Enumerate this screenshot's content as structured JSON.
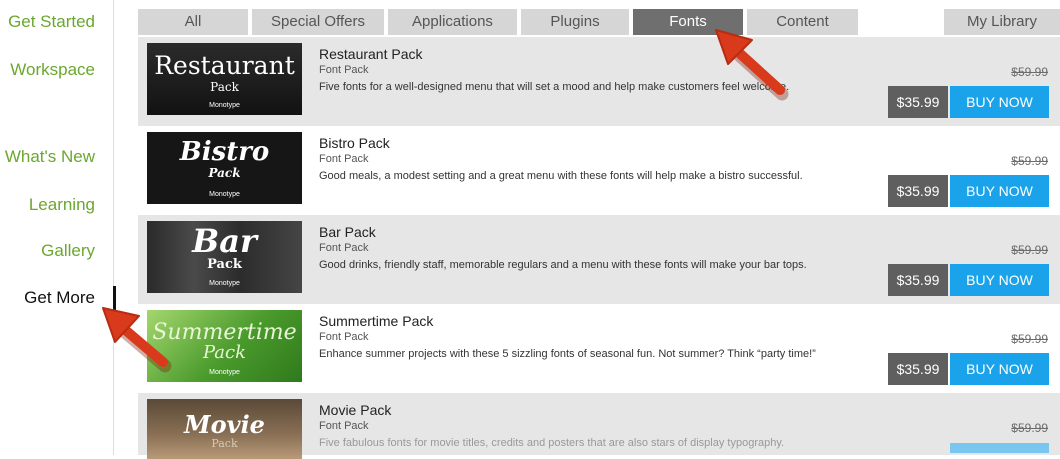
{
  "sidebar": {
    "items": [
      {
        "label": "Get Started"
      },
      {
        "label": "Workspace"
      },
      {
        "label": "What's New"
      },
      {
        "label": "Learning"
      },
      {
        "label": "Gallery"
      },
      {
        "label": "Get More",
        "active": true
      }
    ]
  },
  "tabs": [
    {
      "label": "All"
    },
    {
      "label": "Special Offers"
    },
    {
      "label": "Applications"
    },
    {
      "label": "Plugins"
    },
    {
      "label": "Fonts",
      "active": true
    },
    {
      "label": "Content"
    },
    {
      "label": "My Library"
    }
  ],
  "products": [
    {
      "name": "Restaurant Pack",
      "type": "Font Pack",
      "description": "Five fonts for a well-designed menu that will set a mood and help make customers feel welcome.",
      "old_price": "$59.99",
      "price": "$35.99",
      "buy_label": "BUY NOW",
      "thumb": {
        "title": "Restaurant",
        "pack": "Pack",
        "brand": "Monotype"
      }
    },
    {
      "name": "Bistro Pack",
      "type": "Font Pack",
      "description": "Good meals, a modest setting and a great menu with these fonts will help make a bistro successful.",
      "old_price": "$59.99",
      "price": "$35.99",
      "buy_label": "BUY NOW",
      "thumb": {
        "title": "Bistro",
        "pack": "Pack",
        "brand": "Monotype"
      }
    },
    {
      "name": "Bar Pack",
      "type": "Font Pack",
      "description": "Good drinks, friendly staff, memorable regulars and a menu with these fonts will make your bar tops.",
      "old_price": "$59.99",
      "price": "$35.99",
      "buy_label": "BUY NOW",
      "thumb": {
        "title": "Bar",
        "pack": "Pack",
        "brand": "Monotype"
      }
    },
    {
      "name": "Summertime Pack",
      "type": "Font Pack",
      "description": "Enhance summer projects with these 5 sizzling fonts of seasonal fun. Not summer? Think “party time!”",
      "old_price": "$59.99",
      "price": "$35.99",
      "buy_label": "BUY NOW",
      "thumb": {
        "title": "Summertime",
        "pack": "Pack",
        "brand": "Monotype"
      }
    },
    {
      "name": "Movie Pack",
      "type": "Font Pack",
      "description": "Five fabulous fonts for movie titles, credits and posters that are also stars of display typography.",
      "old_price": "$59.99",
      "price": "",
      "buy_label": "",
      "thumb": {
        "title": "Movie",
        "pack": "Pack",
        "brand": ""
      }
    }
  ],
  "colors": {
    "sidebar_link": "#6aa72f",
    "tab_active": "#6f6f6f",
    "buy_button": "#1aa3ea",
    "price_box": "#5f5f5f",
    "annotation_arrow": "#d93a1c"
  },
  "annotations": [
    "arrow-to-fonts-tab",
    "arrow-to-get-more"
  ]
}
